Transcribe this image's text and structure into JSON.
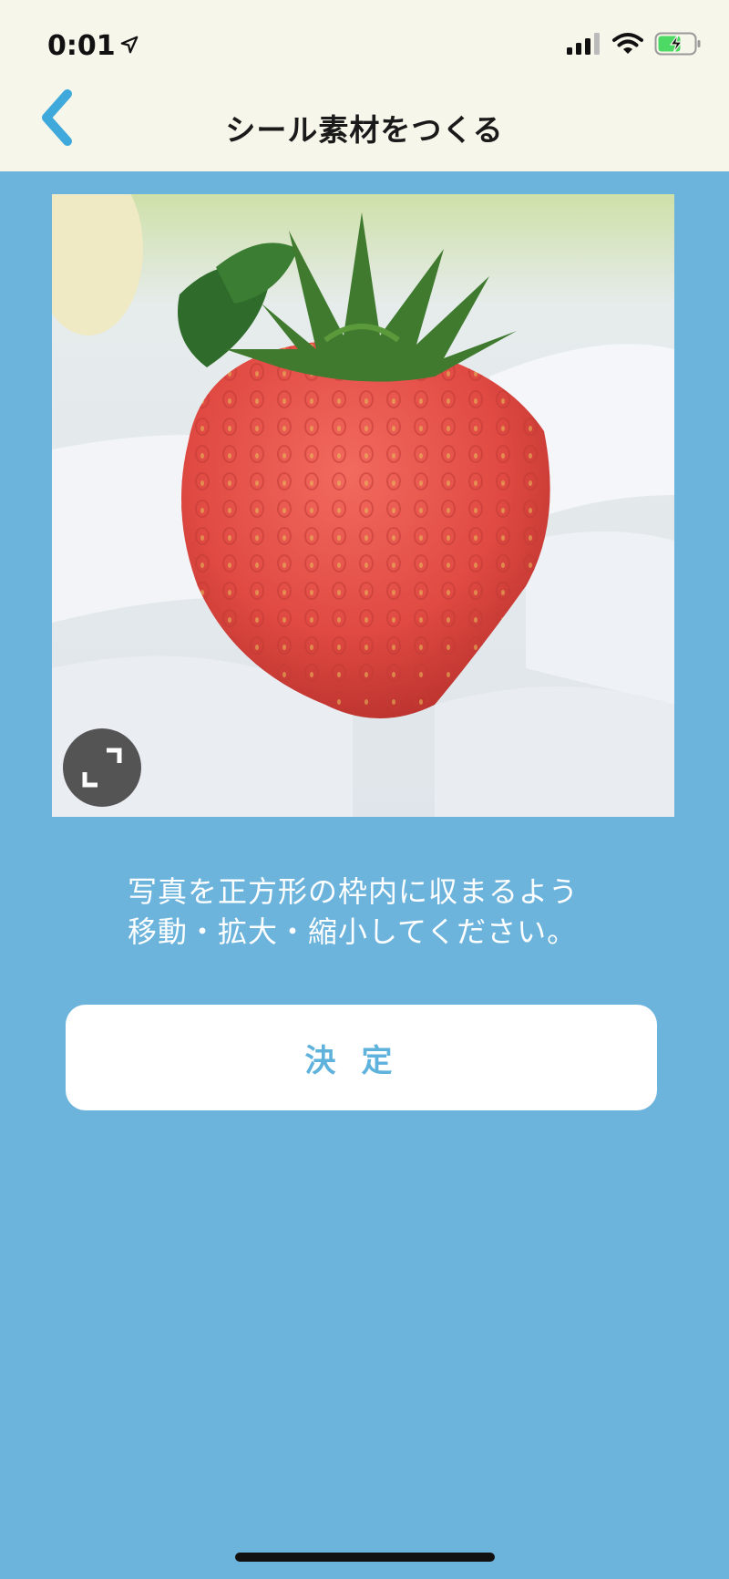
{
  "status_bar": {
    "time": "0:01",
    "icons": [
      "location-arrow-icon",
      "signal-icon",
      "wifi-icon",
      "battery-charging-icon"
    ]
  },
  "nav": {
    "back_icon": "chevron-left-icon",
    "title": "シール素材をつくる"
  },
  "crop": {
    "image_subject": "strawberry",
    "expand_icon": "expand-corners-icon"
  },
  "instructions": {
    "line1": "写真を正方形の枠内に収まるよう",
    "line2": "移動・拡大・縮小してください。"
  },
  "confirm_button": {
    "label": "決定"
  },
  "colors": {
    "background": "#6db4dd",
    "topbar": "#f7f6ea",
    "accent": "#3fa9dc",
    "button_text": "#5fb2dc"
  }
}
